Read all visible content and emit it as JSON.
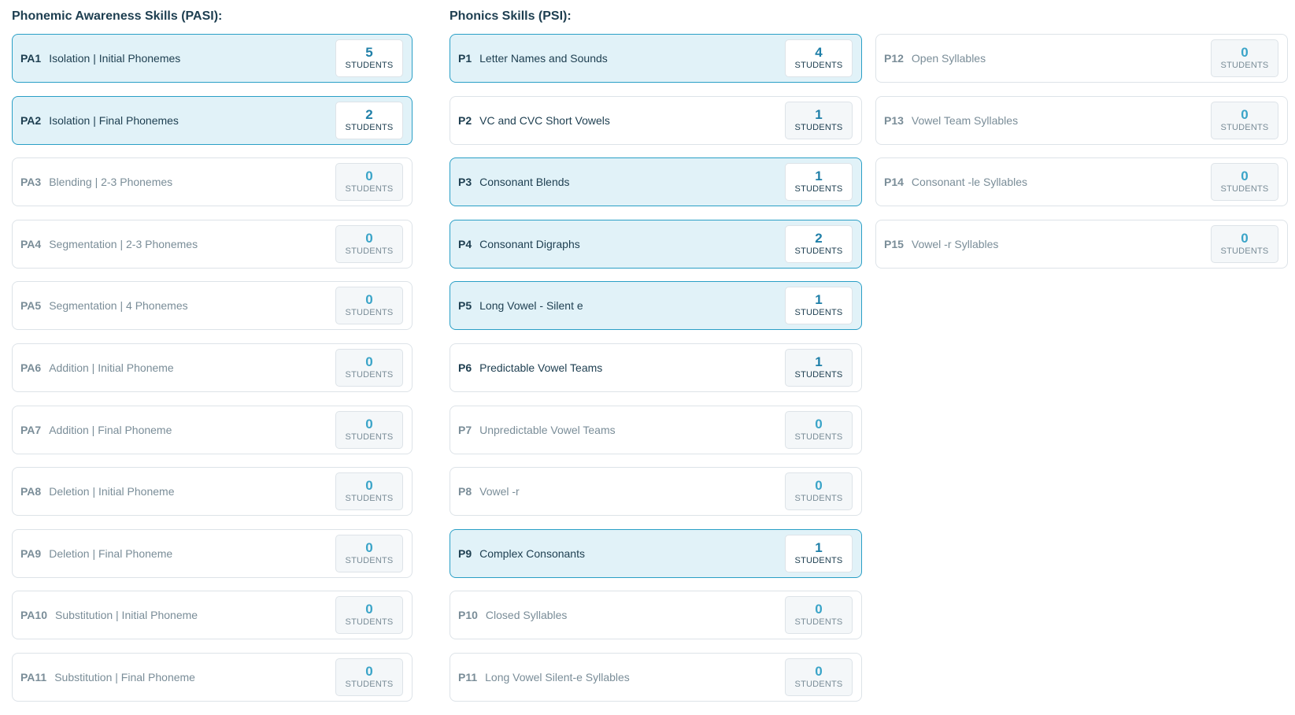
{
  "sections": {
    "pasi_title": "Phonemic Awareness Skills (PASI):",
    "psi_title": "Phonics Skills (PSI):"
  },
  "unit_label": "STUDENTS",
  "pasi": [
    {
      "code": "PA1",
      "name": "Isolation | Initial Phonemes",
      "count": "5",
      "active": true
    },
    {
      "code": "PA2",
      "name": "Isolation | Final Phonemes",
      "count": "2",
      "active": true
    },
    {
      "code": "PA3",
      "name": "Blending | 2-3 Phonemes",
      "count": "0",
      "active": false
    },
    {
      "code": "PA4",
      "name": "Segmentation | 2-3 Phonemes",
      "count": "0",
      "active": false
    },
    {
      "code": "PA5",
      "name": "Segmentation | 4 Phonemes",
      "count": "0",
      "active": false
    },
    {
      "code": "PA6",
      "name": "Addition | Initial Phoneme",
      "count": "0",
      "active": false
    },
    {
      "code": "PA7",
      "name": "Addition | Final Phoneme",
      "count": "0",
      "active": false
    },
    {
      "code": "PA8",
      "name": "Deletion | Initial Phoneme",
      "count": "0",
      "active": false
    },
    {
      "code": "PA9",
      "name": "Deletion | Final Phoneme",
      "count": "0",
      "active": false
    },
    {
      "code": "PA10",
      "name": "Substitution | Initial Phoneme",
      "count": "0",
      "active": false
    },
    {
      "code": "PA11",
      "name": "Substitution | Final Phoneme",
      "count": "0",
      "active": false
    }
  ],
  "psi_col1": [
    {
      "code": "P1",
      "name": "Letter Names and Sounds",
      "count": "4",
      "active": true
    },
    {
      "code": "P2",
      "name": "VC and CVC Short Vowels",
      "count": "1",
      "active": false
    },
    {
      "code": "P3",
      "name": "Consonant Blends",
      "count": "1",
      "active": true
    },
    {
      "code": "P4",
      "name": "Consonant Digraphs",
      "count": "2",
      "active": true
    },
    {
      "code": "P5",
      "name": "Long Vowel - Silent e",
      "count": "1",
      "active": true
    },
    {
      "code": "P6",
      "name": "Predictable Vowel Teams",
      "count": "1",
      "active": false
    },
    {
      "code": "P7",
      "name": "Unpredictable Vowel Teams",
      "count": "0",
      "active": false
    },
    {
      "code": "P8",
      "name": "Vowel -r",
      "count": "0",
      "active": false
    },
    {
      "code": "P9",
      "name": "Complex Consonants",
      "count": "1",
      "active": true
    },
    {
      "code": "P10",
      "name": "Closed Syllables",
      "count": "0",
      "active": false
    },
    {
      "code": "P11",
      "name": "Long Vowel Silent-e Syllables",
      "count": "0",
      "active": false
    }
  ],
  "psi_col2": [
    {
      "code": "P12",
      "name": "Open Syllables",
      "count": "0",
      "active": false
    },
    {
      "code": "P13",
      "name": "Vowel Team Syllables",
      "count": "0",
      "active": false
    },
    {
      "code": "P14",
      "name": "Consonant -le Syllables",
      "count": "0",
      "active": false
    },
    {
      "code": "P15",
      "name": "Vowel -r Syllables",
      "count": "0",
      "active": false
    }
  ]
}
